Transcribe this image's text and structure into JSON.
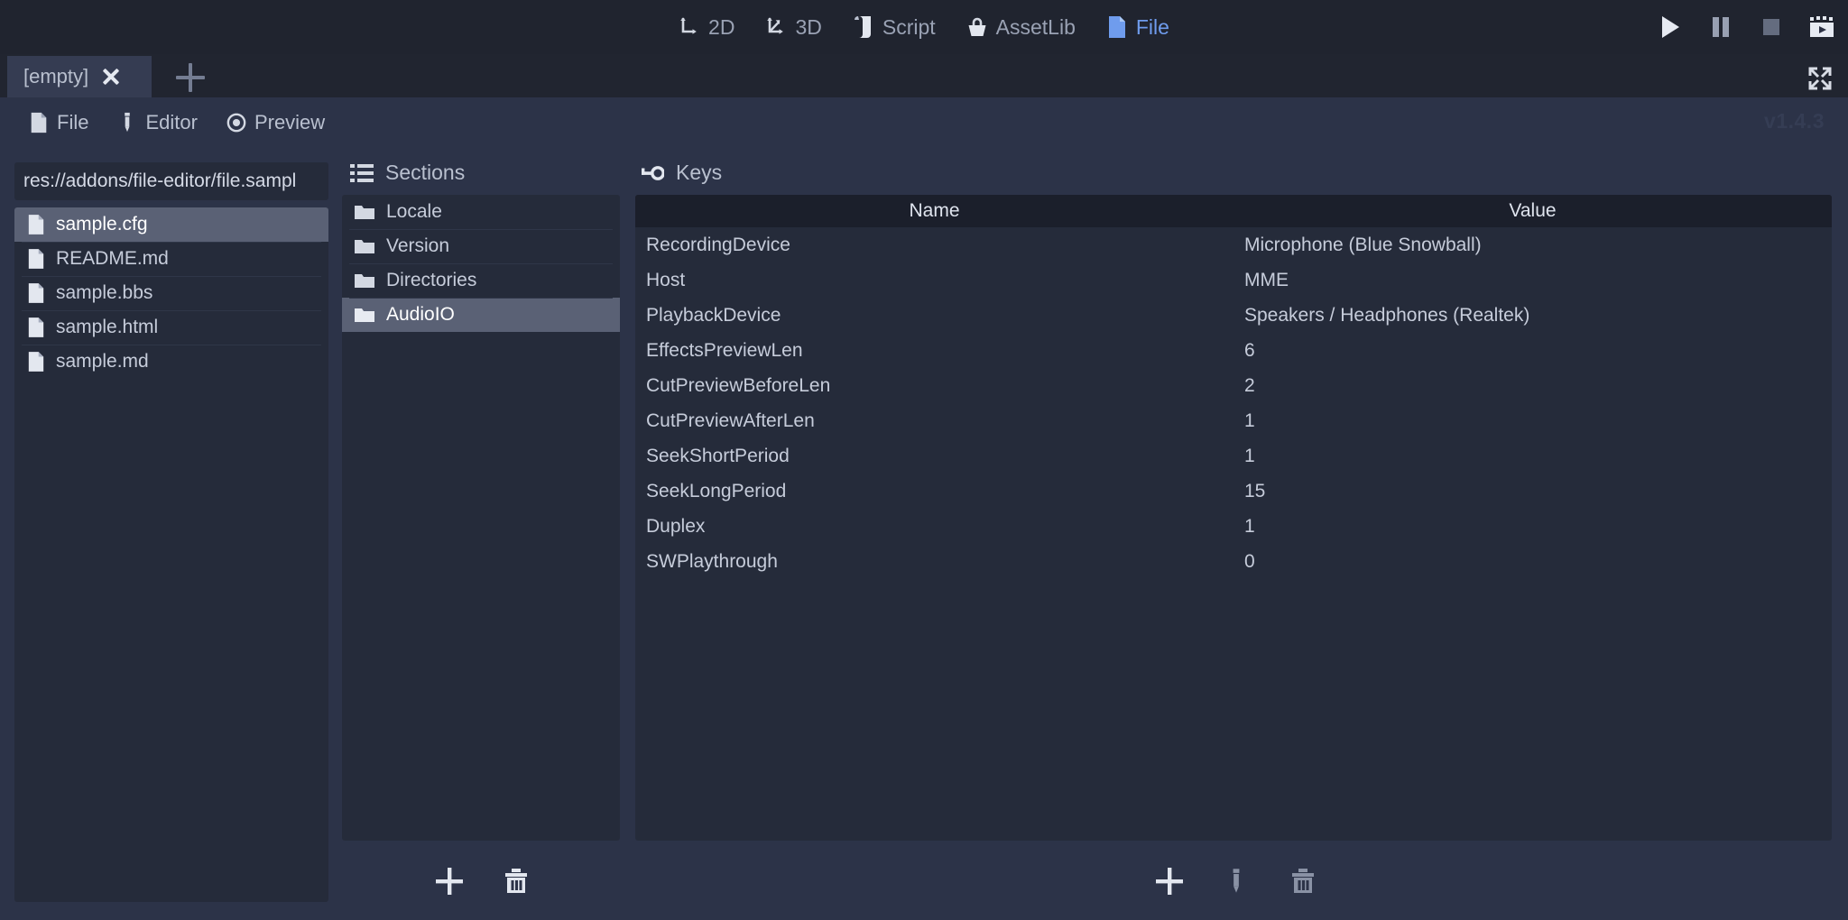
{
  "topbar": {
    "menu_items": [
      {
        "label": "2D",
        "icon": "move-2d-icon",
        "active": false
      },
      {
        "label": "3D",
        "icon": "move-3d-icon",
        "active": false
      },
      {
        "label": "Script",
        "icon": "script-icon",
        "active": false
      },
      {
        "label": "AssetLib",
        "icon": "assetlib-icon",
        "active": false
      },
      {
        "label": "File",
        "icon": "file-blue-icon",
        "active": true
      }
    ],
    "playback": [
      {
        "name": "play-button",
        "icon": "play-icon"
      },
      {
        "name": "pause-button",
        "icon": "pause-icon"
      },
      {
        "name": "stop-button",
        "icon": "stop-icon"
      },
      {
        "name": "movie-write-button",
        "icon": "movie-clip-icon"
      }
    ]
  },
  "tabbar": {
    "tab_label": "[empty]",
    "close_icon": "close-icon",
    "add_icon": "plus-icon",
    "expand_icon": "fullscreen-icon"
  },
  "subtoolbar": {
    "items": [
      {
        "label": "File",
        "icon": "file-icon"
      },
      {
        "label": "Editor",
        "icon": "pencil-icon"
      },
      {
        "label": "Preview",
        "icon": "eye-icon"
      }
    ],
    "version": "v1.4.3"
  },
  "files_panel": {
    "path_value": "res://addons/file-editor/file.sampl",
    "path_placeholder": "res://",
    "items": [
      {
        "label": "sample.cfg",
        "selected": true
      },
      {
        "label": "README.md",
        "selected": false
      },
      {
        "label": "sample.bbs",
        "selected": false
      },
      {
        "label": "sample.html",
        "selected": false
      },
      {
        "label": "sample.md",
        "selected": false
      }
    ]
  },
  "sections_panel": {
    "title": "Sections",
    "title_icon": "list-icon",
    "items": [
      {
        "label": "Locale",
        "selected": false
      },
      {
        "label": "Version",
        "selected": false
      },
      {
        "label": "Directories",
        "selected": false
      },
      {
        "label": "AudioIO",
        "selected": true
      }
    ],
    "footer": [
      {
        "name": "add-section-button",
        "icon": "plus-icon"
      },
      {
        "name": "delete-section-button",
        "icon": "trash-icon"
      }
    ]
  },
  "keys_panel": {
    "title": "Keys",
    "title_icon": "key-icon",
    "columns": [
      "Name",
      "Value"
    ],
    "rows": [
      {
        "name": "RecordingDevice",
        "value": "Microphone (Blue Snowball)"
      },
      {
        "name": "Host",
        "value": "MME"
      },
      {
        "name": "PlaybackDevice",
        "value": "Speakers / Headphones (Realtek)"
      },
      {
        "name": "EffectsPreviewLen",
        "value": "6"
      },
      {
        "name": "CutPreviewBeforeLen",
        "value": "2"
      },
      {
        "name": "CutPreviewAfterLen",
        "value": "1"
      },
      {
        "name": "SeekShortPeriod",
        "value": "1"
      },
      {
        "name": "SeekLongPeriod",
        "value": "15"
      },
      {
        "name": "Duplex",
        "value": "1"
      },
      {
        "name": "SWPlaythrough",
        "value": "0"
      }
    ],
    "footer": [
      {
        "name": "add-key-button",
        "icon": "plus-icon"
      },
      {
        "name": "edit-key-button",
        "icon": "pencil-icon"
      },
      {
        "name": "delete-key-button",
        "icon": "trash-icon"
      }
    ]
  },
  "colors": {
    "background": "#20242f",
    "panel": "#2c3348",
    "list_background": "#252b3a",
    "selection": "#5a6175",
    "accent_blue": "#6f9ced",
    "text": "#c6ccda",
    "header_row": "#1b1f2b"
  }
}
